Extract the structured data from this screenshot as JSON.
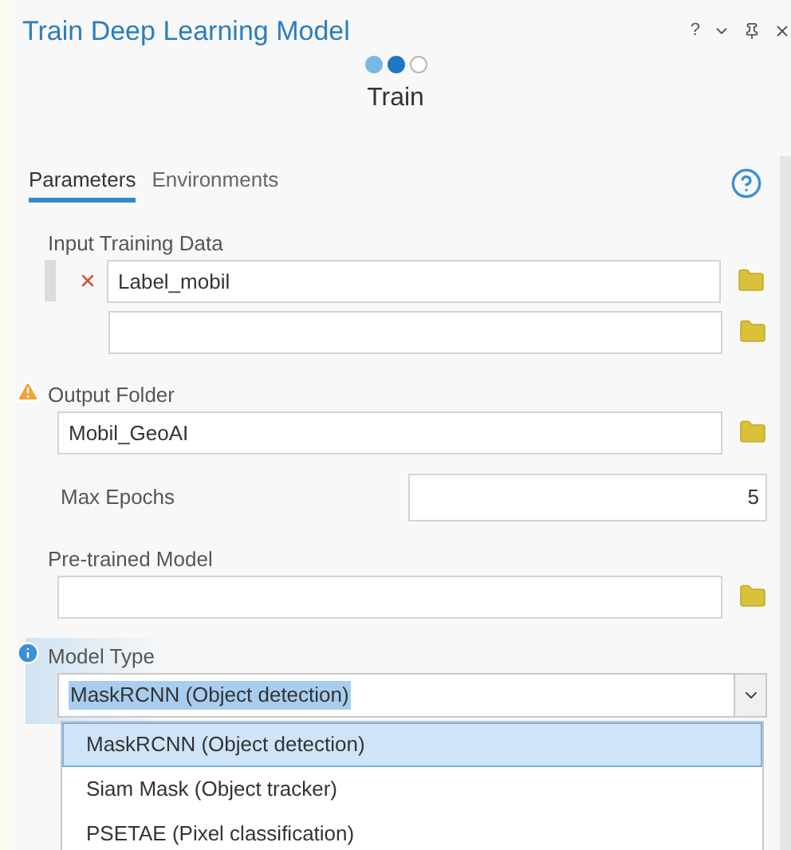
{
  "window": {
    "title": "Train Deep Learning Model",
    "help": "?"
  },
  "steps": [
    {
      "completed": true,
      "current": false
    },
    {
      "completed": false,
      "current": true
    },
    {
      "completed": false,
      "current": false
    }
  ],
  "step_label": "Train",
  "tabs": [
    {
      "label": "Parameters",
      "selected": true
    },
    {
      "label": "Environments",
      "selected": false
    }
  ],
  "parameters": [
    {
      "kind": "multi",
      "label": "Input Training Data",
      "values": [
        "Label_mobil"
      ]
    },
    {
      "kind": "path",
      "label": "Output Folder",
      "warning": true,
      "value": "Mobil_GeoAI"
    },
    {
      "kind": "number",
      "label": "Max Epochs",
      "value": "5"
    },
    {
      "kind": "path",
      "label": "Pre-trained Model"
    },
    {
      "kind": "select",
      "label": "Model Type",
      "info": true,
      "value": "MaskRCNN (Object detection)",
      "expanded": true,
      "options": [
        {
          "label": "MaskRCNN (Object detection)",
          "selected": true
        },
        {
          "label": "Siam Mask (Object tracker)",
          "selected": false
        },
        {
          "label": "PSETAE (Pixel classification)",
          "selected": false
        }
      ]
    }
  ]
}
